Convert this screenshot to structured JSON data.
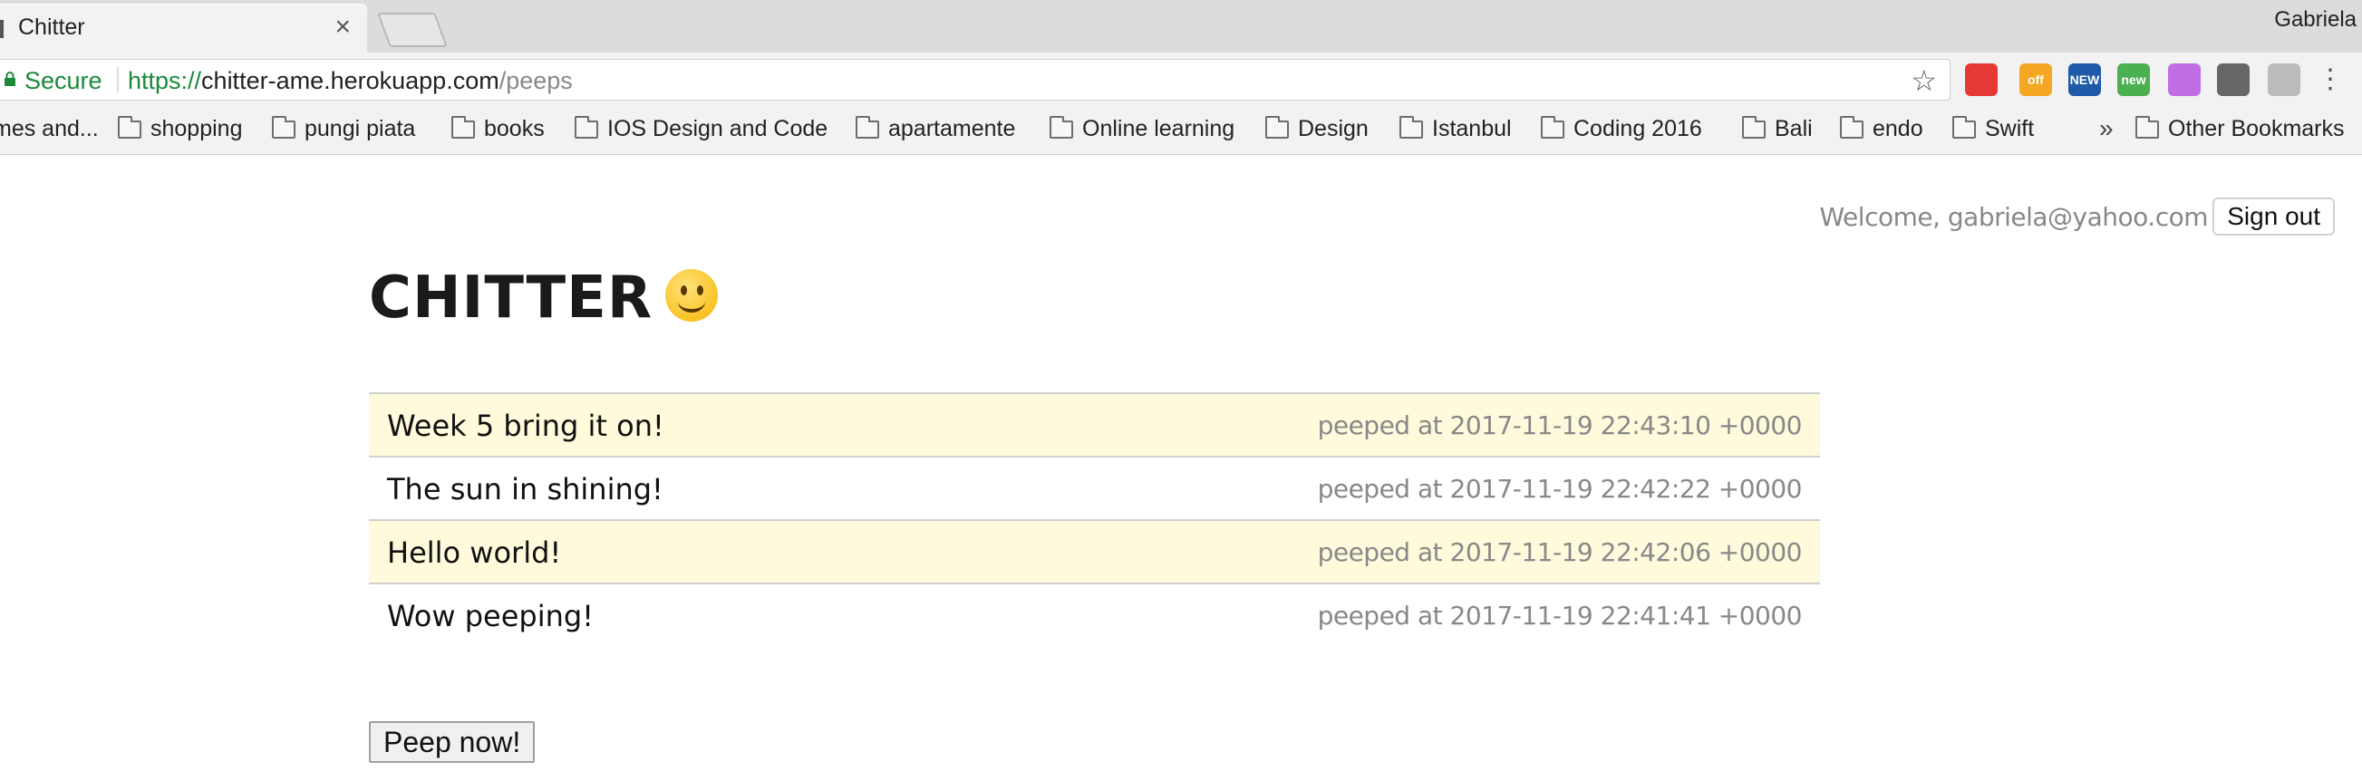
{
  "browser": {
    "tab_title": "Chitter",
    "profile": "Gabriela",
    "secure_label": "Secure",
    "url_scheme": "https://",
    "url_host": "chitter-ame.herokuapp.com",
    "url_path": "/peeps",
    "extensions": [
      {
        "name": "adblock-icon",
        "label": "",
        "color": "#e53935"
      },
      {
        "name": "off-extension-icon",
        "label": "off",
        "color": "#f5a623"
      },
      {
        "name": "new-extension-icon",
        "label": "NEW",
        "color": "#1e5aa8"
      },
      {
        "name": "new-extension-2-icon",
        "label": "new",
        "color": "#4caf50"
      },
      {
        "name": "pocket-extension-icon",
        "label": "",
        "color": "#c06ee6"
      },
      {
        "name": "keep-extension-icon",
        "label": "",
        "color": "#666666"
      },
      {
        "name": "sitemap-extension-icon",
        "label": "",
        "color": "#bbbbbb"
      }
    ],
    "bookmarks": [
      "mes and...",
      "shopping",
      "pungi piata",
      "books",
      "IOS Design and Code",
      "apartamente",
      "Online learning",
      "Design",
      "Istanbul",
      "Coding 2016",
      "Bali",
      "endo",
      "Swift"
    ],
    "bookmarks_overflow": "»",
    "other_bookmarks": "Other Bookmarks"
  },
  "header": {
    "welcome": "Welcome, gabriela@yahoo.com",
    "signout_label": "Sign out"
  },
  "page": {
    "title": "CHITTER",
    "peeps": [
      {
        "text": "Week 5 bring it on!",
        "time": "peeped at 2017-11-19 22:43:10 +0000"
      },
      {
        "text": "The sun in shining!",
        "time": "peeped at 2017-11-19 22:42:22 +0000"
      },
      {
        "text": "Hello world!",
        "time": "peeped at 2017-11-19 22:42:06 +0000"
      },
      {
        "text": "Wow peeping!",
        "time": "peeped at 2017-11-19 22:41:41 +0000"
      }
    ],
    "peep_button_label": "Peep now!"
  }
}
